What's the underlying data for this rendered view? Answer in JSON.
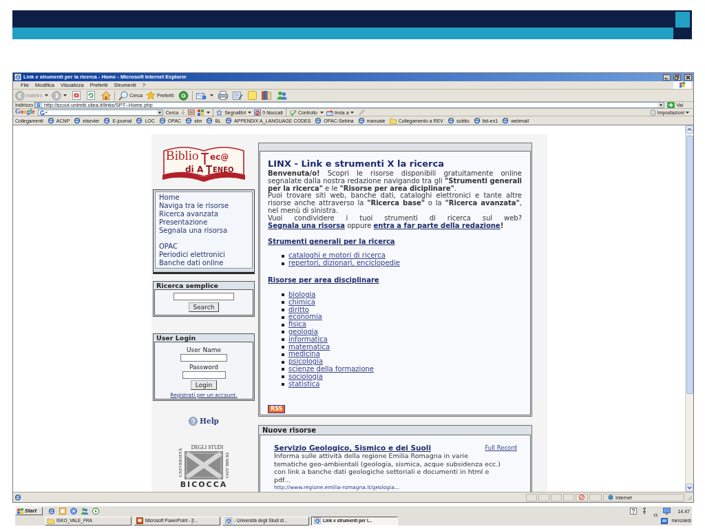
{
  "window": {
    "title": "Link e strumenti per la ricerca - Home - Microsoft Internet Explorer"
  },
  "menu": [
    "File",
    "Modifica",
    "Visualizza",
    "Preferiti",
    "Strumenti",
    "?"
  ],
  "toolbar": {
    "back": {
      "label": "Indietro",
      "disabled": true
    },
    "forward": {
      "disabled": true
    },
    "search": {
      "label": "Cerca"
    },
    "favorites": {
      "label": "Preferiti"
    }
  },
  "address_bar": {
    "label": "Indirizzo",
    "url": "http://scout-unimib.cilea.it/links/SPT--Home.php",
    "go": "Vai"
  },
  "google_toolbar": {
    "logo": "Google",
    "search": "Cerca",
    "bookmarks": "Segnalibri",
    "blocked": "0 bloccati",
    "spellcheck": "Controllo",
    "send": "Invia a",
    "settings": "Impostazioni"
  },
  "links_bar": {
    "label": "Collegamenti",
    "items": [
      {
        "label": "ACNP",
        "kind": "page"
      },
      {
        "label": "elsevier",
        "kind": "page"
      },
      {
        "label": "E-journal",
        "kind": "page"
      },
      {
        "label": "LOC",
        "kind": "page"
      },
      {
        "label": "OPAC",
        "kind": "page"
      },
      {
        "label": "sbn",
        "kind": "page"
      },
      {
        "label": "BL",
        "kind": "page"
      },
      {
        "label": "APPENDIX A_LANGUAGE CODES",
        "kind": "page"
      },
      {
        "label": "OPAC-Sebina",
        "kind": "page"
      },
      {
        "label": "manuale",
        "kind": "page"
      },
      {
        "label": "Collegamento a REV",
        "kind": "folder"
      },
      {
        "label": "subito",
        "kind": "page"
      },
      {
        "label": "list-en1",
        "kind": "page"
      },
      {
        "label": "webmail",
        "kind": "page"
      }
    ]
  },
  "page": {
    "logo": {
      "line_1": [
        "Biblio",
        "ec@"
      ],
      "line_2": [
        "di A",
        "ENEO"
      ]
    },
    "nav": {
      "groups": [
        {
          "items": [
            "Home",
            "Naviga tra le risorse",
            "Ricerca avanzata",
            "Presentazione",
            "Segnala una risorsa"
          ]
        },
        {
          "items": [
            "OPAC",
            "Periodici elettronici",
            "Banche dati online"
          ]
        }
      ]
    },
    "simple_search": {
      "title": "Ricerca semplice",
      "button": "Search"
    },
    "login": {
      "title": "User Login",
      "username_label": "User Name",
      "password_label": "Password",
      "button": "Login",
      "register_link": "Registrati per un account."
    },
    "help": "Help",
    "university_logo": {
      "top": "DEGLI STUDI",
      "left": "UNIVERSITÀ",
      "right": "DI MILANO",
      "bottom": "BICOCCA"
    },
    "main": {
      "title": "LINX - Link e strumenti X la ricerca",
      "intro": [
        {
          "parts": [
            {
              "kind": "text",
              "text": "**Benvenuta/o!** Scopri le risorse disponibili gratuitamente online segnalate dalla nostra redazione navigando tra gli **\"Strumenti generali per la ricerca\"** e le **\"Risorse per area diciplinare\"**."
            }
          ]
        },
        {
          "parts": [
            {
              "kind": "text",
              "text": "Puoi trovare siti web, banche dati, cataloghi elettronici e tante altre risorse anche attraverso la **\"Ricerca base\"** o la **\"Ricerca avanzata\"**, nel menù di sinistra."
            }
          ]
        },
        {
          "parts": [
            {
              "kind": "text",
              "text": "Vuoi condividere i tuoi strumenti di ricerca sul web? "
            },
            {
              "kind": "link",
              "text": "Segnala una risorsa"
            },
            {
              "kind": "text",
              "text": " oppure "
            },
            {
              "kind": "link",
              "text": "entra a far parte della redazione"
            },
            {
              "kind": "text",
              "text": "**!**"
            }
          ]
        }
      ],
      "sections": [
        {
          "heading": "Strumenti generali per la ricerca",
          "items": [
            "cataloghi e motori di ricerca",
            "repertori, dizionari, enciclopedie"
          ]
        },
        {
          "heading": "Risorse per area disciplinare",
          "items": [
            "biologia",
            "chimica",
            "diritto",
            "economia",
            "fisica",
            "geologia",
            "informatica",
            "matematica",
            "medicina",
            "psicologia",
            "scienze della formazione",
            "sociologia",
            "statistica"
          ]
        }
      ],
      "rss": "RSS"
    },
    "news": {
      "title": "Nuove risorse",
      "items": [
        {
          "title": "Servizio Geologico, Sismico e dei Suoli",
          "full_record": "Full Record",
          "description": "Informa sulle attività della regione Emilia Romagna in varie tematiche geo-ambientali (geologia, sismica, acque subsidenza ecc.) con link a banche dati geologiche settoriali e documenti in html e pdf...",
          "url": "http://www.regione.emilia-romagna.it/geologia..."
        }
      ]
    }
  },
  "status_bar": {
    "zone": "Internet"
  },
  "taskbar": {
    "start": "Start",
    "tasks": [
      {
        "label": "ISKO_VALE_FRA",
        "kind": "folder",
        "selected": false
      },
      {
        "label": "Microsoft PowerPoint - [I...",
        "kind": "slides",
        "selected": false
      },
      {
        "label": "- Università degli Studi di...",
        "kind": "browser",
        "selected": false
      },
      {
        "label": "Link e strumenti per l...",
        "kind": "browser",
        "selected": true
      }
    ],
    "time": "14.47",
    "day": "mercoledì"
  }
}
